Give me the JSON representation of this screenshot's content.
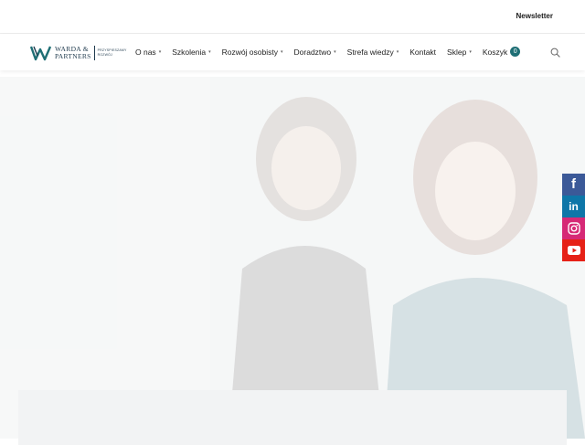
{
  "topbar": {
    "newsletter_label": "Newsletter"
  },
  "logo": {
    "line1": "WARDA &",
    "line2": "PARTNERS",
    "tagline1": "PRZYSPIESZAMY",
    "tagline2": "ROZWÓJ"
  },
  "nav": {
    "items": [
      {
        "label": "O nas",
        "dropdown": true
      },
      {
        "label": "Szkolenia",
        "dropdown": true
      },
      {
        "label": "Rozwój osobisty",
        "dropdown": true
      },
      {
        "label": "Doradztwo",
        "dropdown": true
      },
      {
        "label": "Strefa wiedzy",
        "dropdown": true
      },
      {
        "label": "Kontakt",
        "dropdown": false
      },
      {
        "label": "Sklep",
        "dropdown": true
      }
    ],
    "cart_label": "Koszyk",
    "cart_count": "0",
    "search_icon": "search-icon"
  },
  "social": [
    {
      "name": "facebook-icon",
      "color": "#3b5998"
    },
    {
      "name": "linkedin-icon",
      "color": "#0e76a8"
    },
    {
      "name": "instagram-icon",
      "color": "#d62976"
    },
    {
      "name": "youtube-icon",
      "color": "#e62117"
    }
  ],
  "colors": {
    "accent": "#1f6f75",
    "logo": "#1f3a4d"
  }
}
